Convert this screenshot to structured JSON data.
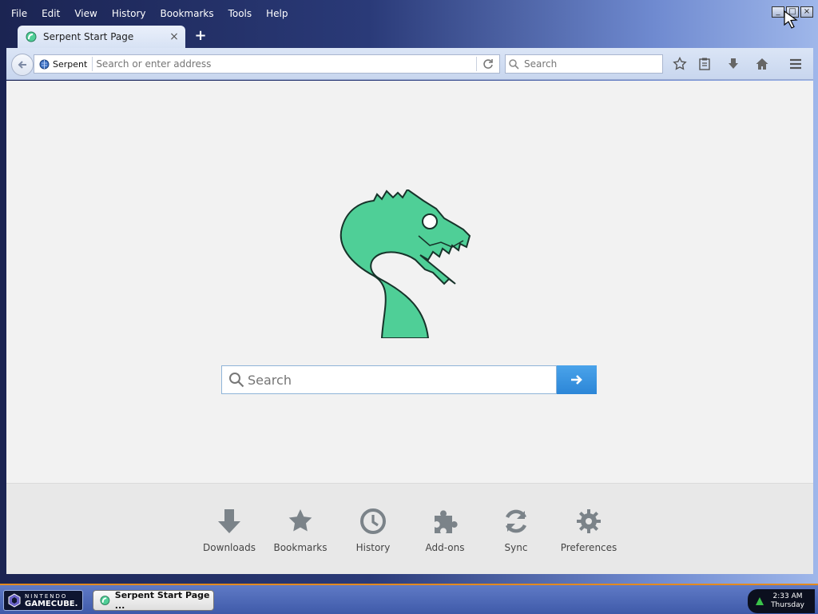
{
  "menu": [
    "File",
    "Edit",
    "View",
    "History",
    "Bookmarks",
    "Tools",
    "Help"
  ],
  "tab": {
    "title": "Serpent Start Page",
    "close": "×",
    "new_tab": "+"
  },
  "window_controls": {
    "minimize": "_",
    "maximize": "□",
    "close": "×"
  },
  "navbar": {
    "site_identity": "Serpent",
    "url_placeholder": "Search or enter address",
    "search_placeholder": "Search"
  },
  "content": {
    "search_placeholder": "Search",
    "launchers": [
      {
        "label": "Downloads",
        "icon": "download-icon"
      },
      {
        "label": "Bookmarks",
        "icon": "star-icon"
      },
      {
        "label": "History",
        "icon": "clock-icon"
      },
      {
        "label": "Add-ons",
        "icon": "puzzle-icon"
      },
      {
        "label": "Sync",
        "icon": "sync-icon"
      },
      {
        "label": "Preferences",
        "icon": "gear-icon"
      }
    ]
  },
  "taskbar": {
    "start_line1": "NINTENDO",
    "start_line2": "GAMECUBE.",
    "task_title": "Serpent Start Page ...",
    "time": "2:33 AM",
    "day": "Thursday"
  },
  "colors": {
    "accent": "#2c86d7",
    "logo": "#4fcf97"
  }
}
